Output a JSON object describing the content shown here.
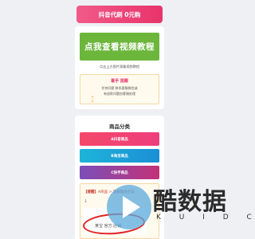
{
  "header": {
    "title": "抖音代刷 0元购"
  },
  "video_card": {
    "button_label": "点我查看视频教程",
    "hint": "点击上方图片观看视频教程",
    "notice_title": "着手 提醒",
    "notice_line_1": "任何问题 联系客服微信或",
    "notice_line_2": "有退款问题由客服处理"
  },
  "categories": {
    "title": "商品分类",
    "items": [
      {
        "label": "A抖音商品"
      },
      {
        "label": "B淘宝商品"
      },
      {
        "label": "C快手商品"
      }
    ]
  },
  "promo": {
    "tag": "【提醒】",
    "text": "A商品 > 请截图后点击",
    "image_label": "某宝 官方 店铺"
  },
  "watermark": {
    "title": "酷数据",
    "subtitle": "K U I D C"
  }
}
